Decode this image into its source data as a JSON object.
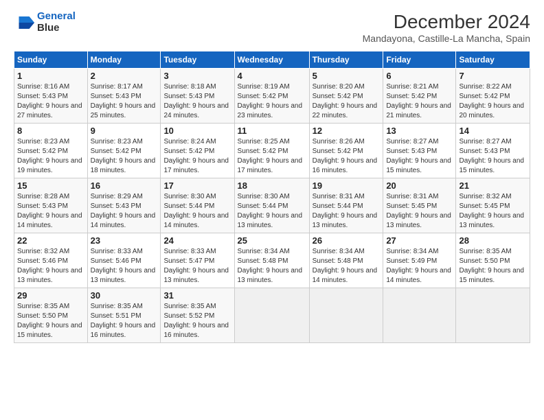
{
  "header": {
    "logo_line1": "General",
    "logo_line2": "Blue",
    "title": "December 2024",
    "subtitle": "Mandayona, Castille-La Mancha, Spain"
  },
  "columns": [
    "Sunday",
    "Monday",
    "Tuesday",
    "Wednesday",
    "Thursday",
    "Friday",
    "Saturday"
  ],
  "rows": [
    [
      {
        "day": "1",
        "sunrise": "8:16 AM",
        "sunset": "5:43 PM",
        "daylight": "9 hours and 27 minutes."
      },
      {
        "day": "2",
        "sunrise": "8:17 AM",
        "sunset": "5:43 PM",
        "daylight": "9 hours and 25 minutes."
      },
      {
        "day": "3",
        "sunrise": "8:18 AM",
        "sunset": "5:43 PM",
        "daylight": "9 hours and 24 minutes."
      },
      {
        "day": "4",
        "sunrise": "8:19 AM",
        "sunset": "5:42 PM",
        "daylight": "9 hours and 23 minutes."
      },
      {
        "day": "5",
        "sunrise": "8:20 AM",
        "sunset": "5:42 PM",
        "daylight": "9 hours and 22 minutes."
      },
      {
        "day": "6",
        "sunrise": "8:21 AM",
        "sunset": "5:42 PM",
        "daylight": "9 hours and 21 minutes."
      },
      {
        "day": "7",
        "sunrise": "8:22 AM",
        "sunset": "5:42 PM",
        "daylight": "9 hours and 20 minutes."
      }
    ],
    [
      {
        "day": "8",
        "sunrise": "8:23 AM",
        "sunset": "5:42 PM",
        "daylight": "9 hours and 19 minutes."
      },
      {
        "day": "9",
        "sunrise": "8:23 AM",
        "sunset": "5:42 PM",
        "daylight": "9 hours and 18 minutes."
      },
      {
        "day": "10",
        "sunrise": "8:24 AM",
        "sunset": "5:42 PM",
        "daylight": "9 hours and 17 minutes."
      },
      {
        "day": "11",
        "sunrise": "8:25 AM",
        "sunset": "5:42 PM",
        "daylight": "9 hours and 17 minutes."
      },
      {
        "day": "12",
        "sunrise": "8:26 AM",
        "sunset": "5:42 PM",
        "daylight": "9 hours and 16 minutes."
      },
      {
        "day": "13",
        "sunrise": "8:27 AM",
        "sunset": "5:43 PM",
        "daylight": "9 hours and 15 minutes."
      },
      {
        "day": "14",
        "sunrise": "8:27 AM",
        "sunset": "5:43 PM",
        "daylight": "9 hours and 15 minutes."
      }
    ],
    [
      {
        "day": "15",
        "sunrise": "8:28 AM",
        "sunset": "5:43 PM",
        "daylight": "9 hours and 14 minutes."
      },
      {
        "day": "16",
        "sunrise": "8:29 AM",
        "sunset": "5:43 PM",
        "daylight": "9 hours and 14 minutes."
      },
      {
        "day": "17",
        "sunrise": "8:30 AM",
        "sunset": "5:44 PM",
        "daylight": "9 hours and 14 minutes."
      },
      {
        "day": "18",
        "sunrise": "8:30 AM",
        "sunset": "5:44 PM",
        "daylight": "9 hours and 13 minutes."
      },
      {
        "day": "19",
        "sunrise": "8:31 AM",
        "sunset": "5:44 PM",
        "daylight": "9 hours and 13 minutes."
      },
      {
        "day": "20",
        "sunrise": "8:31 AM",
        "sunset": "5:45 PM",
        "daylight": "9 hours and 13 minutes."
      },
      {
        "day": "21",
        "sunrise": "8:32 AM",
        "sunset": "5:45 PM",
        "daylight": "9 hours and 13 minutes."
      }
    ],
    [
      {
        "day": "22",
        "sunrise": "8:32 AM",
        "sunset": "5:46 PM",
        "daylight": "9 hours and 13 minutes."
      },
      {
        "day": "23",
        "sunrise": "8:33 AM",
        "sunset": "5:46 PM",
        "daylight": "9 hours and 13 minutes."
      },
      {
        "day": "24",
        "sunrise": "8:33 AM",
        "sunset": "5:47 PM",
        "daylight": "9 hours and 13 minutes."
      },
      {
        "day": "25",
        "sunrise": "8:34 AM",
        "sunset": "5:48 PM",
        "daylight": "9 hours and 13 minutes."
      },
      {
        "day": "26",
        "sunrise": "8:34 AM",
        "sunset": "5:48 PM",
        "daylight": "9 hours and 14 minutes."
      },
      {
        "day": "27",
        "sunrise": "8:34 AM",
        "sunset": "5:49 PM",
        "daylight": "9 hours and 14 minutes."
      },
      {
        "day": "28",
        "sunrise": "8:35 AM",
        "sunset": "5:50 PM",
        "daylight": "9 hours and 15 minutes."
      }
    ],
    [
      {
        "day": "29",
        "sunrise": "8:35 AM",
        "sunset": "5:50 PM",
        "daylight": "9 hours and 15 minutes."
      },
      {
        "day": "30",
        "sunrise": "8:35 AM",
        "sunset": "5:51 PM",
        "daylight": "9 hours and 16 minutes."
      },
      {
        "day": "31",
        "sunrise": "8:35 AM",
        "sunset": "5:52 PM",
        "daylight": "9 hours and 16 minutes."
      },
      null,
      null,
      null,
      null
    ]
  ]
}
